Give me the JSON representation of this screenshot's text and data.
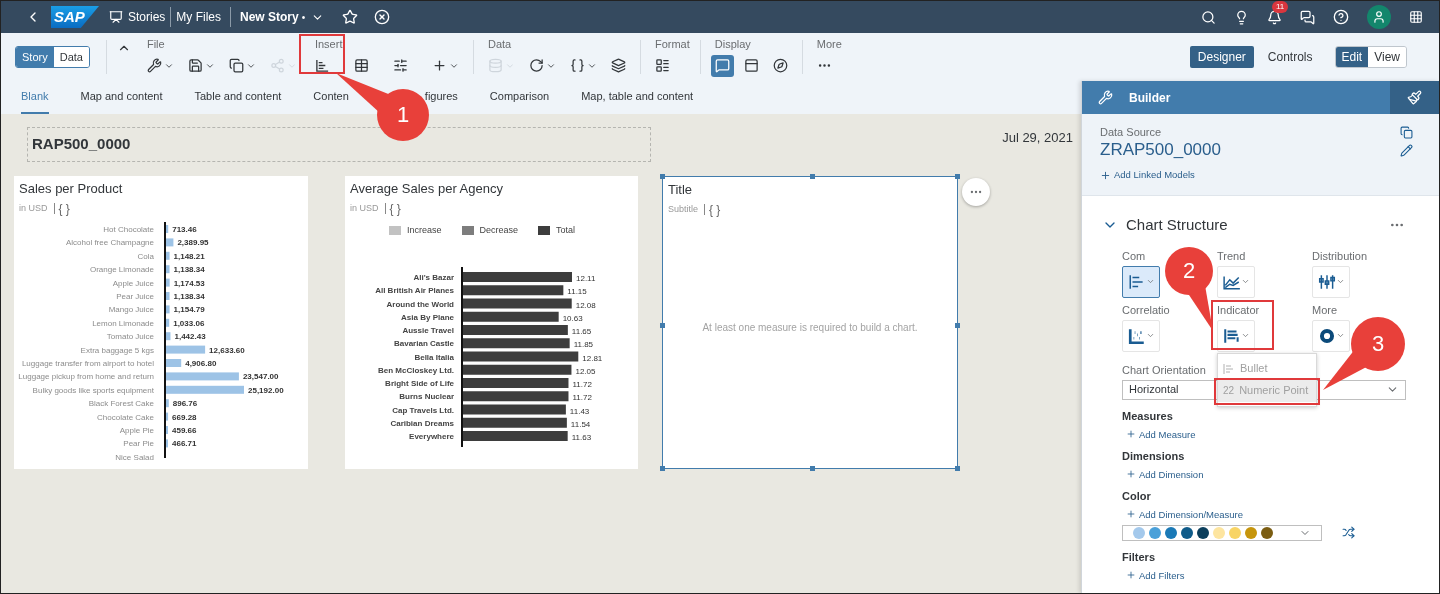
{
  "shell": {
    "logo": "SAP",
    "links": [
      {
        "label": "Stories"
      },
      {
        "label": "My Files"
      }
    ],
    "story": {
      "title": "New Story",
      "unsaved_mark": "•"
    },
    "notification_count": "11"
  },
  "toolbar": {
    "view_toggle": [
      {
        "label": "Story",
        "selected": true
      },
      {
        "label": "Data",
        "selected": false
      }
    ],
    "groups": [
      {
        "label": "File",
        "tools": [
          {
            "dropdown": true,
            "disabled": false
          },
          {
            "dropdown": true,
            "disabled": false
          },
          {
            "dropdown": true,
            "disabled": false
          },
          {
            "dropdown": true,
            "disabled": true
          }
        ]
      },
      {
        "label": "Insert",
        "tools": [
          {
            "dropdown": false,
            "disabled": false
          },
          {
            "dropdown": false,
            "disabled": false
          },
          {
            "dropdown": false,
            "disabled": false
          },
          {
            "dropdown": true,
            "disabled": false
          }
        ]
      },
      {
        "label": "Data",
        "tools": [
          {
            "dropdown": true,
            "disabled": true
          },
          {
            "dropdown": true,
            "disabled": false
          },
          {
            "dropdown": true,
            "disabled": false
          },
          {
            "dropdown": false,
            "disabled": false
          }
        ]
      },
      {
        "label": "Format",
        "tools": [
          {
            "dropdown": false,
            "disabled": false
          }
        ]
      },
      {
        "label": "Display",
        "tools": [
          {
            "dropdown": false,
            "disabled": false,
            "selected": true
          },
          {
            "dropdown": false,
            "disabled": false,
            "selected": false
          },
          {
            "dropdown": false,
            "disabled": false,
            "selected": false
          }
        ]
      },
      {
        "label": "More",
        "tools": [
          {
            "dropdown": false,
            "disabled": false
          }
        ]
      }
    ],
    "modes": [
      {
        "label": "Designer",
        "selected": true
      },
      {
        "label": "Controls",
        "selected": false
      }
    ],
    "edit_toggle": [
      {
        "label": "Edit",
        "selected": true
      },
      {
        "label": "View",
        "selected": false
      }
    ]
  },
  "layout_tabs": [
    {
      "label": "Blank",
      "selected": true
    },
    {
      "label": "Map and content",
      "selected": false
    },
    {
      "label": "Table and content",
      "selected": false
    },
    {
      "label": "Conten",
      "label_end": "figures",
      "selected": false
    },
    {
      "label": "Comparison",
      "selected": false
    },
    {
      "label": "Map, table and content",
      "selected": false
    }
  ],
  "canvas": {
    "header": {
      "title": "RAP500_0000",
      "date": "Jul 29, 2021"
    },
    "widgets": [
      {
        "kind": "chart",
        "title": "Sales per Product",
        "subtitle": "in USD",
        "braces": "{ }",
        "selected": false,
        "chart_data": {
          "type": "bar",
          "orientation": "horizontal",
          "categories": [
            "Hot Chocolate",
            "Alcohol free Champagne",
            "Cola",
            "Orange Limonade",
            "Apple Juice",
            "Pear Juice",
            "Mango Juice",
            "Lemon Limonade",
            "Tomato Juice",
            "Extra baggage 5 kgs",
            "Luggage transfer from airport to hotel",
            "Luggage pickup from home and return",
            "Bulky goods like sports equipment",
            "Black Forest Cake",
            "Chocolate Cake",
            "Apple Pie",
            "Pear Pie",
            "Nice Salad"
          ],
          "values": [
            713.46,
            2389.95,
            1148.21,
            1138.34,
            1174.53,
            1138.34,
            1154.79,
            1033.06,
            1442.43,
            12633.6,
            4906.8,
            23547,
            25192,
            896.76,
            669.28,
            459.66,
            466.71,
            null
          ],
          "data_labels": true,
          "value_labels": [
            "713.46",
            "2,389.95",
            "1,148.21",
            "1,138.34",
            "1,174.53",
            "1,138.34",
            "1,154.79",
            "1,033.06",
            "1,442.43",
            "12,633.60",
            "4,906.80",
            "23,547.00",
            "25,192.00",
            "896.76",
            "669.28",
            "459.66",
            "466.71",
            null
          ]
        }
      },
      {
        "kind": "chart",
        "title": "Average Sales per Agency",
        "subtitle": "in USD",
        "braces": "{ }",
        "selected": false,
        "legend": [
          {
            "label": "Increase",
            "color": "#c2c2c2"
          },
          {
            "label": "Decrease",
            "color": "#7d7d7d"
          },
          {
            "label": "Total",
            "color": "#3d3d3d"
          }
        ],
        "chart_data": {
          "type": "bar",
          "orientation": "horizontal",
          "categories": [
            "Ali's Bazar",
            "All British Air Planes",
            "Around the World",
            "Asia By Plane",
            "Aussie Travel",
            "Bavarian Castle",
            "Bella Italia",
            "Ben McCloskey Ltd.",
            "Bright Side of Life",
            "Burns Nuclear",
            "Cap Travels Ltd.",
            "Caribian Dreams",
            "Everywhere"
          ],
          "values": [
            12.11,
            11.15,
            12.08,
            10.63,
            11.65,
            11.85,
            12.81,
            12.05,
            11.72,
            11.72,
            11.43,
            11.54,
            11.63
          ],
          "data_labels": true,
          "value_labels": [
            "12.11",
            "11.15",
            "12.08",
            "10.63",
            "11.65",
            "11.85",
            "12.81",
            "12.05",
            "11.72",
            "11.72",
            "11.43",
            "11.54",
            "11.63"
          ]
        }
      },
      {
        "kind": "empty",
        "title": "Title",
        "subtitle": "Subtitle",
        "braces": "{ }",
        "message": "At least one measure is required to build a chart.",
        "selected": true
      }
    ]
  },
  "builder": {
    "title": "Builder",
    "data_source": {
      "label": "Data Source",
      "name": "ZRAP500_0000",
      "action": "Add Linked Models"
    },
    "section": {
      "title": "Chart Structure",
      "expanded": true
    },
    "chart_types": [
      {
        "label": "Com",
        "selected": true
      },
      {
        "label": "Trend",
        "selected": false
      },
      {
        "label": "Distribution",
        "selected": false
      },
      {
        "label": "Correlatio",
        "selected": false
      },
      {
        "label": "Indicator",
        "selected": false,
        "menu": [
          {
            "label": "Bullet",
            "selected": false
          },
          {
            "label": "Numeric Point",
            "glyph": "22",
            "selected": true
          }
        ]
      },
      {
        "label": "More",
        "selected": false
      }
    ],
    "orientation": {
      "label": "Chart Orientation",
      "value": "Horizontal"
    },
    "fields": [
      {
        "label": "Measures",
        "action": "Add Measure"
      },
      {
        "label": "Dimensions",
        "action": "Add Dimension"
      },
      {
        "label": "Color",
        "action": "Add Dimension/Measure",
        "palette": [
          {
            "color": "#a4c9ec"
          },
          {
            "color": "#4aa0d9"
          },
          {
            "color": "#1a79b6"
          },
          {
            "color": "#0f5b89"
          },
          {
            "color": "#0b3e5c"
          },
          {
            "color": "#fde5a0"
          },
          {
            "color": "#f8d464"
          },
          {
            "color": "#c6950c"
          },
          {
            "color": "#7b5d12"
          }
        ]
      },
      {
        "label": "Filters",
        "action": "Add Filters"
      }
    ]
  },
  "callouts": [
    {
      "number": "1"
    },
    {
      "number": "2"
    },
    {
      "number": "3"
    }
  ]
}
